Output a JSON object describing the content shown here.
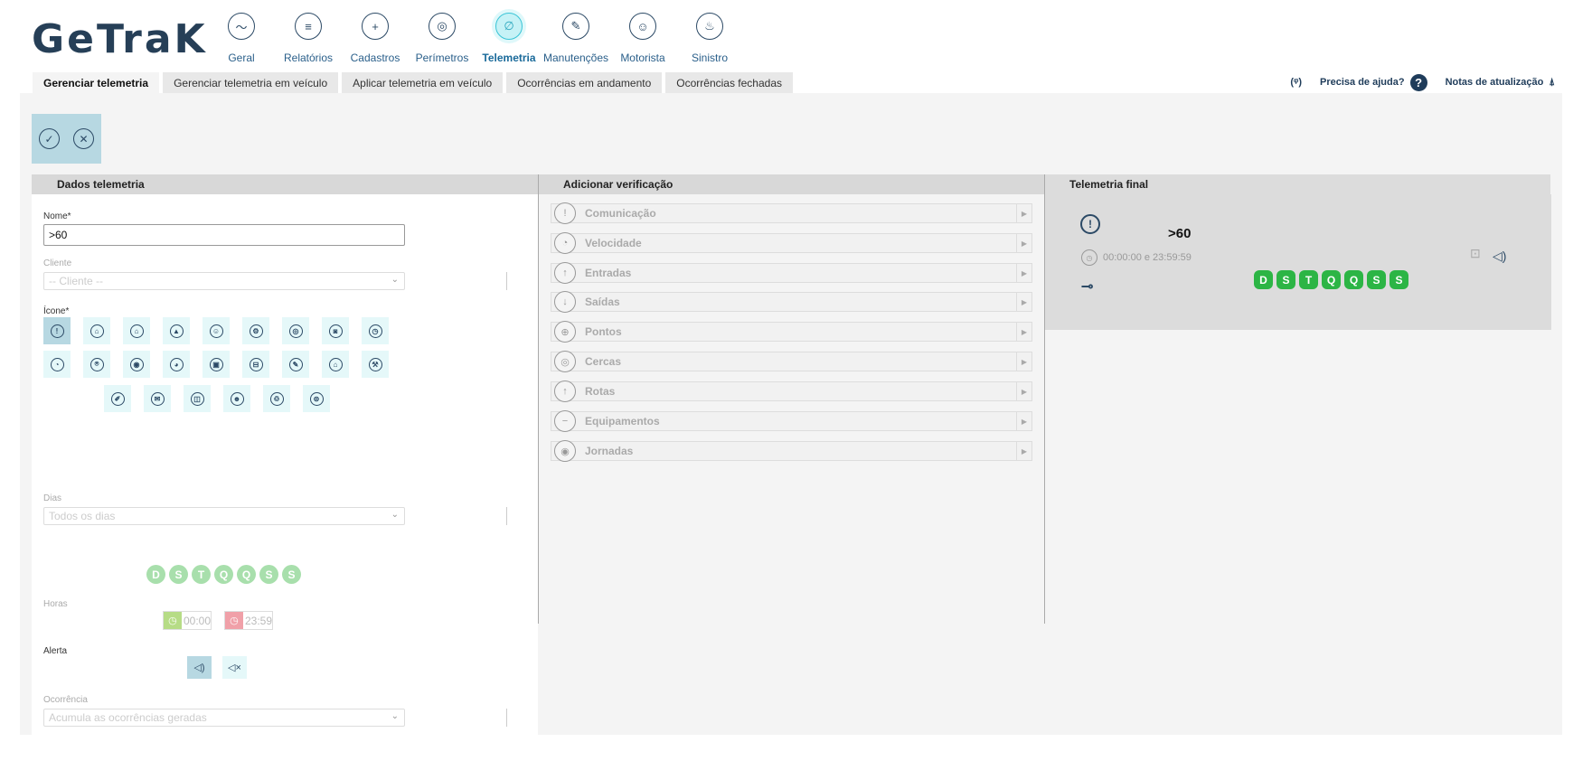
{
  "app": {
    "logo": "GeTraK"
  },
  "nav": [
    {
      "label": "Geral",
      "icon": "monitor-icon",
      "glyph": "〜"
    },
    {
      "label": "Relatórios",
      "icon": "report-icon",
      "glyph": "≡"
    },
    {
      "label": "Cadastros",
      "icon": "folder-add-icon",
      "glyph": "+"
    },
    {
      "label": "Perímetros",
      "icon": "target-icon",
      "glyph": "◎"
    },
    {
      "label": "Telemetria",
      "icon": "compass-icon",
      "glyph": "∅",
      "active": true
    },
    {
      "label": "Manutenções",
      "icon": "wrench-icon",
      "glyph": "✎"
    },
    {
      "label": "Motorista",
      "icon": "driver-icon",
      "glyph": "☺"
    },
    {
      "label": "Sinistro",
      "icon": "siren-icon",
      "glyph": "♨"
    }
  ],
  "tabs": [
    {
      "label": "Gerenciar telemetria",
      "active": true
    },
    {
      "label": "Gerenciar telemetria em veículo"
    },
    {
      "label": "Aplicar telemetria em veículo"
    },
    {
      "label": "Ocorrências em andamento"
    },
    {
      "label": "Ocorrências fechadas"
    }
  ],
  "help": {
    "antenna_icon": "antenna-icon",
    "help_label": "Precisa de ajuda?",
    "help_glyph": "?",
    "notes_label": "Notas de atualização",
    "notes_icon": "gift-icon"
  },
  "actions": {
    "confirm_glyph": "✓",
    "cancel_glyph": "✕"
  },
  "panels": {
    "dados": {
      "title": "Dados telemetria",
      "nome_label": "Nome*",
      "nome_value": ">60",
      "cliente_label": "Cliente",
      "cliente_value": "-- Cliente --",
      "icone_label": "Ícone*",
      "icon_rows": [
        [
          "!",
          "⌂",
          "⌂",
          "▲",
          "☺",
          "⚙",
          "◎",
          "◙",
          "◷"
        ],
        [
          "◔",
          "⍟",
          "◉",
          "◕",
          "▣",
          "⊟",
          "✎",
          "⌂",
          "⚒"
        ],
        [
          "✐",
          "✉",
          "◫",
          "☻",
          "♲",
          "⊜"
        ]
      ],
      "dias_label": "Dias",
      "dias_value": "Todos os dias",
      "days": [
        "D",
        "S",
        "T",
        "Q",
        "Q",
        "S",
        "S"
      ],
      "horas_label": "Horas",
      "hora_inicio": "00:00",
      "hora_fim": "23:59",
      "alerta_label": "Alerta",
      "alert_on_glyph": "◁)",
      "alert_off_glyph": "◁×",
      "ocorrencia_label": "Ocorrência",
      "ocorrencia_value": "Acumula as ocorrências geradas"
    },
    "verificacao": {
      "title": "Adicionar verificação",
      "items": [
        {
          "label": "Comunicação",
          "glyph": "!"
        },
        {
          "label": "Velocidade",
          "glyph": "◔"
        },
        {
          "label": "Entradas",
          "glyph": "↑"
        },
        {
          "label": "Saídas",
          "glyph": "↓"
        },
        {
          "label": "Pontos",
          "glyph": "⊕"
        },
        {
          "label": "Cercas",
          "glyph": "◎"
        },
        {
          "label": "Rotas",
          "glyph": "↑"
        },
        {
          "label": "Equipamentos",
          "glyph": "−"
        },
        {
          "label": "Jornadas",
          "glyph": "◉"
        }
      ]
    },
    "final": {
      "title": "Telemetria final",
      "name": ">60",
      "icon_glyph": "!",
      "time_range": "00:00:00 e 23:59:59",
      "key_glyph": "⊸",
      "lock_glyph": "⊡",
      "speaker_glyph": "◁)",
      "days": [
        "D",
        "S",
        "T",
        "Q",
        "Q",
        "S",
        "S"
      ]
    }
  },
  "colors": {
    "accent": "#263f57",
    "active_day": "#2cb545",
    "light_day": "#a8dfac",
    "selected": "#b7d8e2"
  }
}
